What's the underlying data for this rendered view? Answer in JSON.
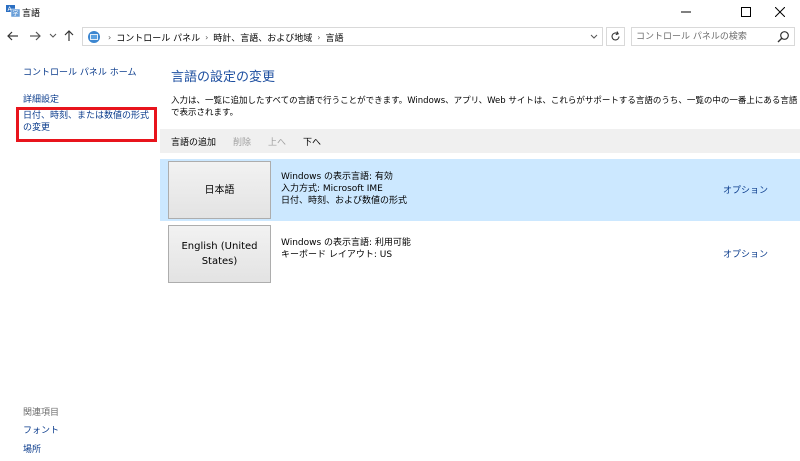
{
  "window": {
    "title": "言語"
  },
  "nav": {
    "breadcrumbs": [
      "コントロール パネル",
      "時計、言語、および地域",
      "言語"
    ],
    "search_placeholder": "コントロール パネルの検索"
  },
  "sidebar": {
    "home": "コントロール パネル ホーム",
    "advanced": "詳細設定",
    "date_format": "日付、時刻、または数値の形式の変更",
    "related_header": "関連項目",
    "font": "フォント",
    "location": "場所"
  },
  "main": {
    "title": "言語の設定の変更",
    "description": "入力は、一覧に追加したすべての言語で行うことができます。Windows、アプリ、Web サイトは、これらがサポートする言語のうち、一覧の中の一番上にある言語で表示されます。",
    "toolbar": {
      "add": "言語の追加",
      "remove": "削除",
      "up": "上へ",
      "down": "下へ"
    },
    "languages": [
      {
        "name": "日本語",
        "info": [
          "Windows の表示言語: 有効",
          "入力方式: Microsoft IME",
          "日付、時刻、および数値の形式"
        ],
        "options": "オプション",
        "selected": true
      },
      {
        "name": "English (United States)",
        "info": [
          "Windows の表示言語: 利用可能",
          "キーボード レイアウト: US"
        ],
        "options": "オプション",
        "selected": false
      }
    ]
  },
  "colors": {
    "link": "#0a3b8c",
    "title": "#1e4fa0",
    "selection": "#cce8ff",
    "highlight_box": "#e8141c",
    "toolbar_bg": "#f0f0f0"
  }
}
